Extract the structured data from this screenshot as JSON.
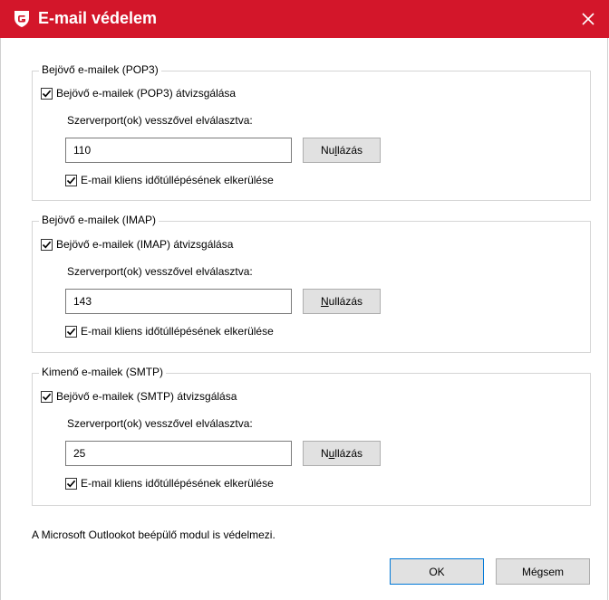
{
  "window": {
    "title": "E-mail védelem",
    "accent_color": "#d3162a"
  },
  "groups": [
    {
      "legend": "Bejövő e-mailek (POP3)",
      "scan_label": "Bejövő e-mailek (POP3) átvizsgálása",
      "scan_checked": true,
      "port_label": "Szerverport(ok) vesszővel elválasztva:",
      "port_value": "110",
      "reset_pre": "Nu",
      "reset_hot": "l",
      "reset_post": "lázás",
      "timeout_label": "E-mail kliens időtúllépésének elkerülése",
      "timeout_checked": true
    },
    {
      "legend": "Bejövő e-mailek (IMAP)",
      "scan_label": "Bejövő e-mailek (IMAP) átvizsgálása",
      "scan_checked": true,
      "port_label": "Szerverport(ok) vesszővel elválasztva:",
      "port_value": "143",
      "reset_pre": "",
      "reset_hot": "N",
      "reset_post": "ullázás",
      "timeout_label": "E-mail kliens időtúllépésének elkerülése",
      "timeout_checked": true
    },
    {
      "legend": "Kimenő e-mailek (SMTP)",
      "scan_label": "Bejövő e-mailek (SMTP) átvizsgálása",
      "scan_checked": true,
      "port_label": "Szerverport(ok) vesszővel elválasztva:",
      "port_value": "25",
      "reset_pre": "N",
      "reset_hot": "u",
      "reset_post": "llázás",
      "timeout_label": "E-mail kliens időtúllépésének elkerülése",
      "timeout_checked": true
    }
  ],
  "footer": {
    "note": "A Microsoft Outlookot beépülő modul is védelmezi.",
    "ok_label": "OK",
    "cancel_label": "Mégsem"
  }
}
